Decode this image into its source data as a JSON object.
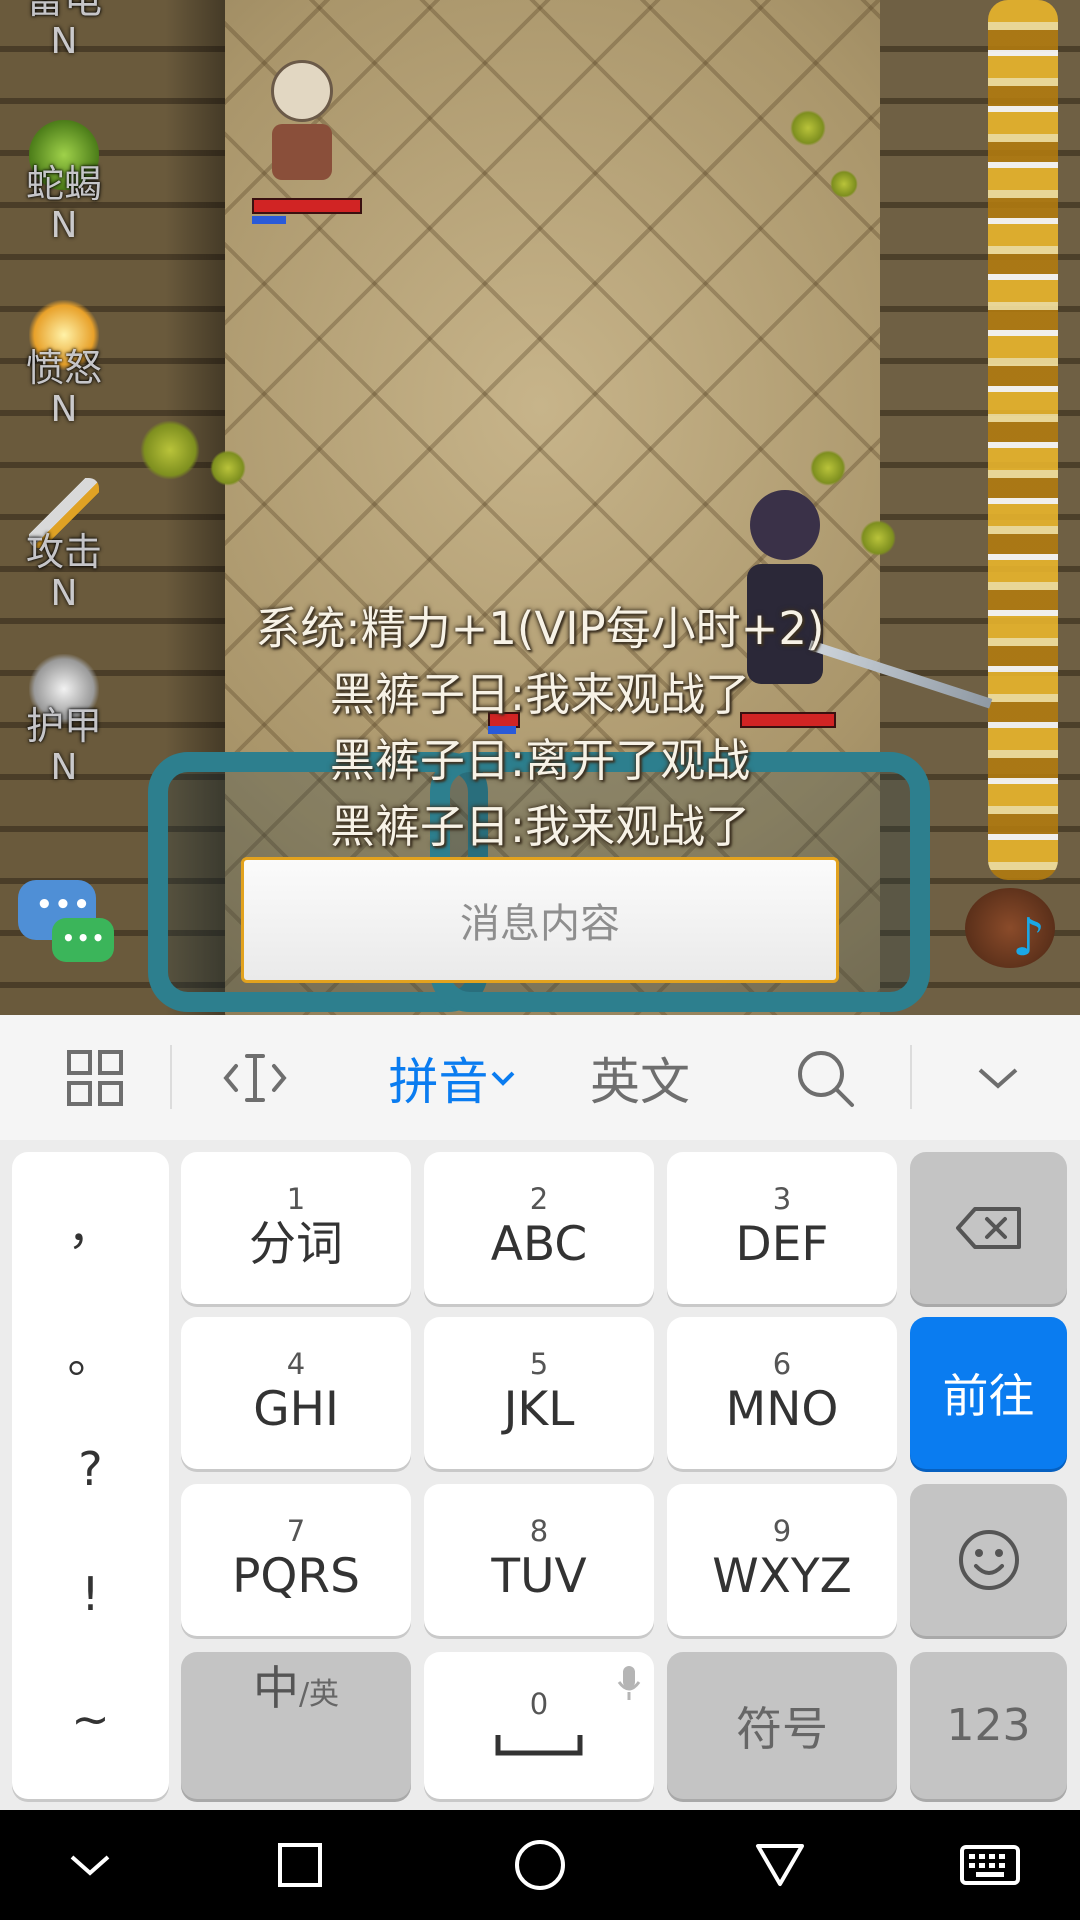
{
  "game": {
    "skills": [
      {
        "label": "雷电",
        "status": "N"
      },
      {
        "label": "蛇蝎",
        "status": "N"
      },
      {
        "label": "愤怒",
        "status": "N"
      },
      {
        "label": "攻击",
        "status": "N"
      },
      {
        "label": "护甲",
        "status": "N"
      }
    ],
    "chat_messages": [
      "系统:精力+1(VIP每小时+2)",
      "黑裤子日:我来观战了",
      "黑裤子日:离开了观战",
      "黑裤子日:我来观战了"
    ],
    "chat_dots": "•••",
    "message_input": {
      "placeholder": "消息内容",
      "value": ""
    }
  },
  "keyboard": {
    "toolbar": {
      "grid_icon": "grid-icon",
      "cursor_icon": "cursor-move-icon",
      "pinyin_label": "拼音",
      "english_label": "英文",
      "search_icon": "search-icon",
      "collapse_icon": "chevron-down-icon",
      "active_color": "#0a7cf0"
    },
    "punctuation": [
      "，",
      "。",
      "?",
      "!",
      "~"
    ],
    "rows": [
      [
        {
          "num": "1",
          "main": "分词"
        },
        {
          "num": "2",
          "main": "ABC"
        },
        {
          "num": "3",
          "main": "DEF"
        }
      ],
      [
        {
          "num": "4",
          "main": "GHI"
        },
        {
          "num": "5",
          "main": "JKL"
        },
        {
          "num": "6",
          "main": "MNO"
        }
      ],
      [
        {
          "num": "7",
          "main": "PQRS"
        },
        {
          "num": "8",
          "main": "TUV"
        },
        {
          "num": "9",
          "main": "WXYZ"
        }
      ]
    ],
    "backspace_icon": "backspace-icon",
    "go_label": "前往",
    "emoji_icon": "emoji-icon",
    "lang_switch": {
      "main": "中",
      "sub": "/英"
    },
    "space": {
      "num": "0",
      "icon": "space-bar-icon",
      "mic_icon": "microphone-icon"
    },
    "symbols_label": "符号",
    "numbers_label": "123"
  },
  "navbar": {
    "icons": [
      "hide-keyboard-chevron-icon",
      "recents-square-icon",
      "home-circle-icon",
      "back-triangle-icon",
      "keyboard-icon"
    ]
  }
}
